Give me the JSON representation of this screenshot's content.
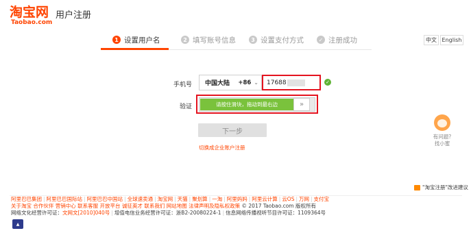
{
  "header": {
    "logo_cn": "淘宝网",
    "logo_en": "Taobao.com",
    "title": "用户注册"
  },
  "steps": [
    {
      "num": "1",
      "label": "设置用户名",
      "active": true
    },
    {
      "num": "2",
      "label": "填写账号信息",
      "active": false
    },
    {
      "num": "3",
      "label": "设置支付方式",
      "active": false
    },
    {
      "num": "✓",
      "label": "注册成功",
      "active": false
    }
  ],
  "lang": {
    "zh": "中文",
    "en": "English"
  },
  "form": {
    "phone_label": "手机号",
    "country": "中国大陆",
    "country_code": "+86",
    "phone_value": "17688",
    "verify_label": "验证",
    "slider_text": "请按住滑块，拖动到最右边",
    "slider_handle": "»",
    "next_button": "下一步",
    "enterprise_link": "切换成企业账户注册"
  },
  "help": {
    "line1": "有问题?",
    "line2": "找小蜜"
  },
  "feedback": "\"淘宝注册\"改进建议",
  "footer": {
    "links_row1": [
      "阿里巴巴集团",
      "阿里巴巴国际站",
      "阿里巴巴中国站",
      "全球速卖通",
      "淘宝网",
      "天猫",
      "聚划算",
      "一淘",
      "阿里妈妈",
      "阿里云计算",
      "云OS",
      "万网",
      "支付宝"
    ],
    "links_row2": [
      "关于淘宝",
      "合作伙伴",
      "营销中心",
      "联系客服",
      "开放平台",
      "诚征英才",
      "联系我们",
      "网站地图",
      "法律声明及隐私权政策"
    ],
    "copyright": "© 2017 Taobao.com 版权所有",
    "license_label": "网络文化经营许可证：",
    "license_link": "文网文[2010]040号",
    "telecom": "增值电信业务经营许可证：浙B2-20080224-1",
    "av_license": "信息网络传播视听节目许可证：1109364号"
  },
  "colors": {
    "brand": "#ff4400",
    "success": "#7ac23c",
    "highlight": "#e4131f"
  }
}
